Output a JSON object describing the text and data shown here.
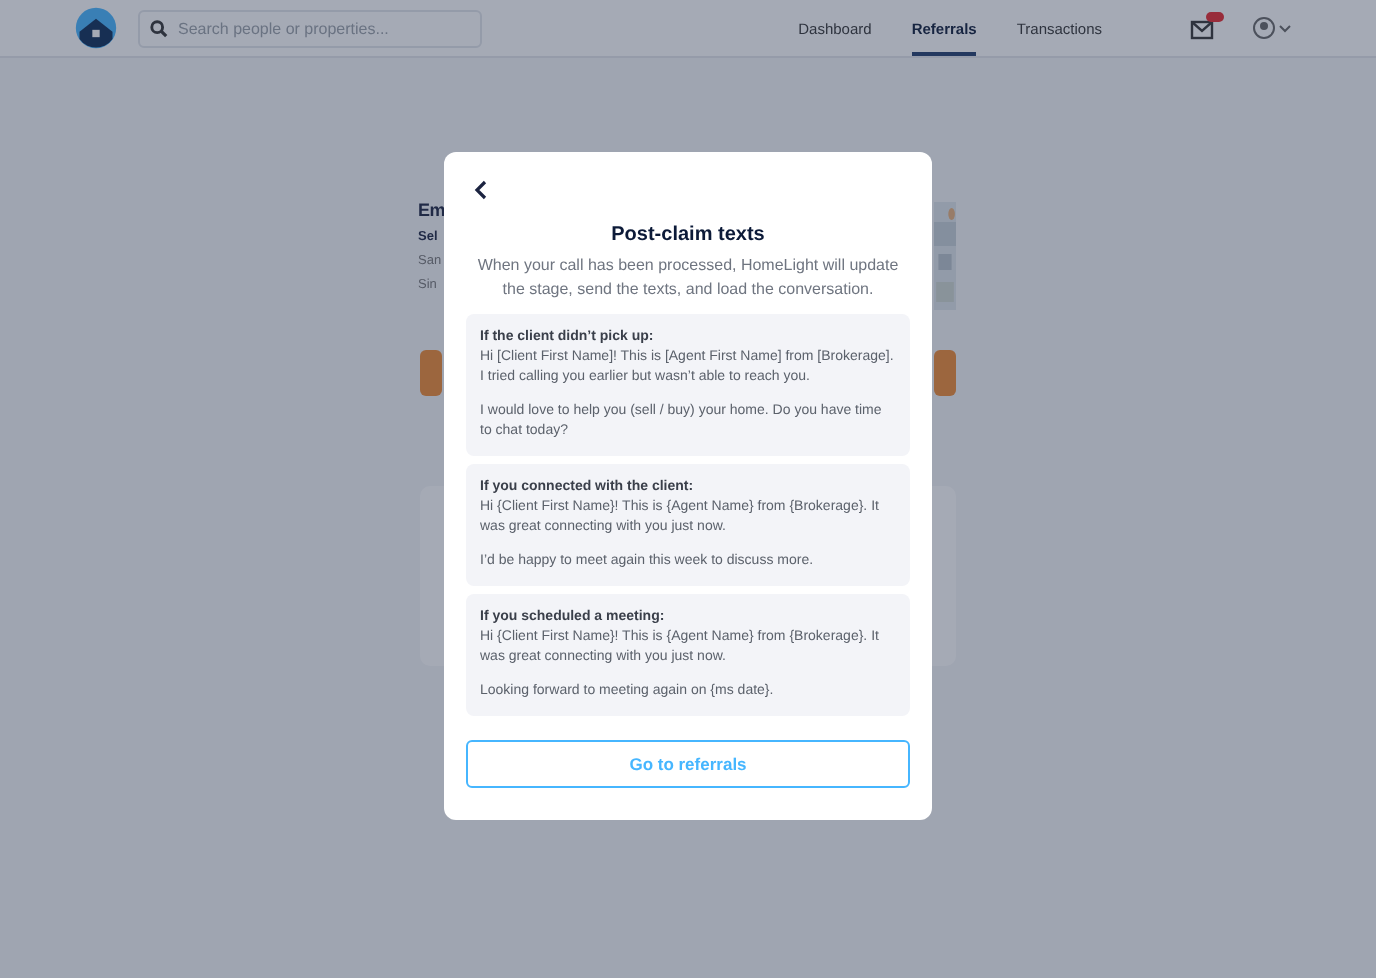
{
  "header": {
    "search": {
      "placeholder": "Search people or properties..."
    },
    "nav": [
      {
        "label": "Dashboard",
        "selected": false
      },
      {
        "label": "Referrals",
        "selected": true
      },
      {
        "label": "Transactions",
        "selected": false
      }
    ],
    "unread": true
  },
  "background": {
    "lines": [
      {
        "text": "Em",
        "kind": "heading"
      },
      {
        "text": "Sel",
        "kind": "subheading"
      },
      {
        "text": "San",
        "kind": "detail"
      },
      {
        "text": "Sin",
        "kind": "detail"
      }
    ]
  },
  "modal": {
    "title": "Post-claim texts",
    "subtitle": "When your call has been processed, HomeLight will update the stage, send the texts, and load the conversation.",
    "sections": [
      {
        "heading": "If the client didn’t pick up:",
        "paragraphs": [
          "Hi [Client First Name]! This is [Agent First Name] from [Brokerage]. I tried calling you earlier but wasn’t able to reach you.",
          "I would love to help you (sell / buy) your home. Do you have time to chat today?"
        ]
      },
      {
        "heading": "If you connected with the client:",
        "paragraphs": [
          "Hi {Client First Name}! This is {Agent Name} from {Brokerage}. It was great connecting with you just now.",
          "I’d be happy to meet again this week to discuss more."
        ]
      },
      {
        "heading": "If you scheduled a meeting:",
        "paragraphs": [
          "Hi {Client First Name}! This is {Agent Name} from {Brokerage}. It was great connecting with you just now.",
          "Looking forward to meeting again on {ms date}."
        ]
      }
    ],
    "button": "Go to referrals"
  }
}
